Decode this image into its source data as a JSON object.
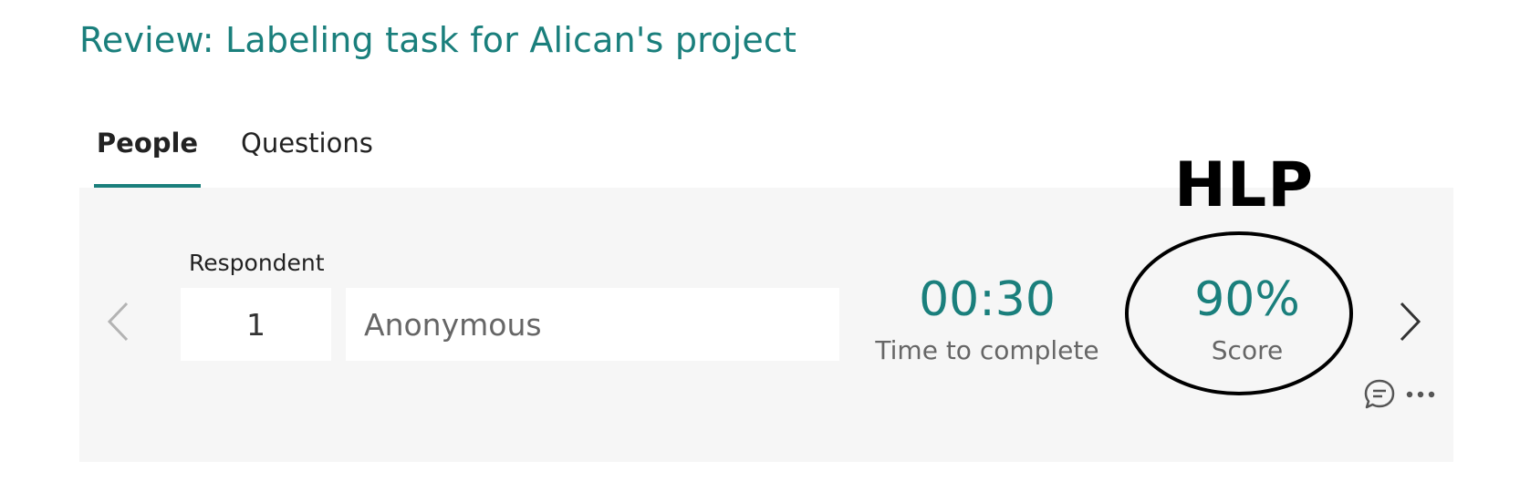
{
  "header": {
    "title": "Review: Labeling task for Alican's project"
  },
  "tabs": [
    {
      "label": "People",
      "active": true
    },
    {
      "label": "Questions",
      "active": false
    }
  ],
  "respondent": {
    "label": "Respondent",
    "number": "1",
    "name": "Anonymous"
  },
  "stats": {
    "time_value": "00:30",
    "time_label": "Time to complete",
    "score_value": "90%",
    "score_label": "Score"
  },
  "annotation": {
    "text": "HLP"
  },
  "icons": {
    "prev": "chevron-left-icon",
    "next": "chevron-right-icon",
    "comment": "comment-icon",
    "more": "more-icon"
  },
  "colors": {
    "accent": "#1a7f7c",
    "panel_bg": "#f6f6f6"
  }
}
